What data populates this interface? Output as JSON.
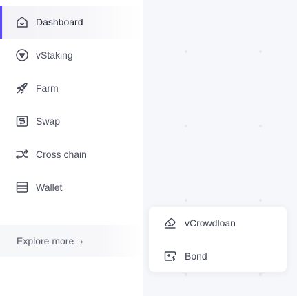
{
  "sidebar": {
    "items": [
      {
        "label": "Dashboard",
        "icon": "home-icon",
        "active": true
      },
      {
        "label": "vStaking",
        "icon": "staking-icon",
        "active": false
      },
      {
        "label": "Farm",
        "icon": "farm-icon",
        "active": false
      },
      {
        "label": "Swap",
        "icon": "swap-icon",
        "active": false
      },
      {
        "label": "Cross chain",
        "icon": "cross-chain-icon",
        "active": false
      },
      {
        "label": "Wallet",
        "icon": "wallet-icon",
        "active": false
      }
    ],
    "explore": {
      "label": "Explore more",
      "chevron": "›"
    }
  },
  "popup": {
    "items": [
      {
        "label": "vCrowdloan",
        "icon": "crowdloan-icon"
      },
      {
        "label": "Bond",
        "icon": "bond-icon"
      }
    ]
  },
  "colors": {
    "accent": "#5b4cf0",
    "text": "#3f4352",
    "panel_bg": "#f6f7fa"
  }
}
